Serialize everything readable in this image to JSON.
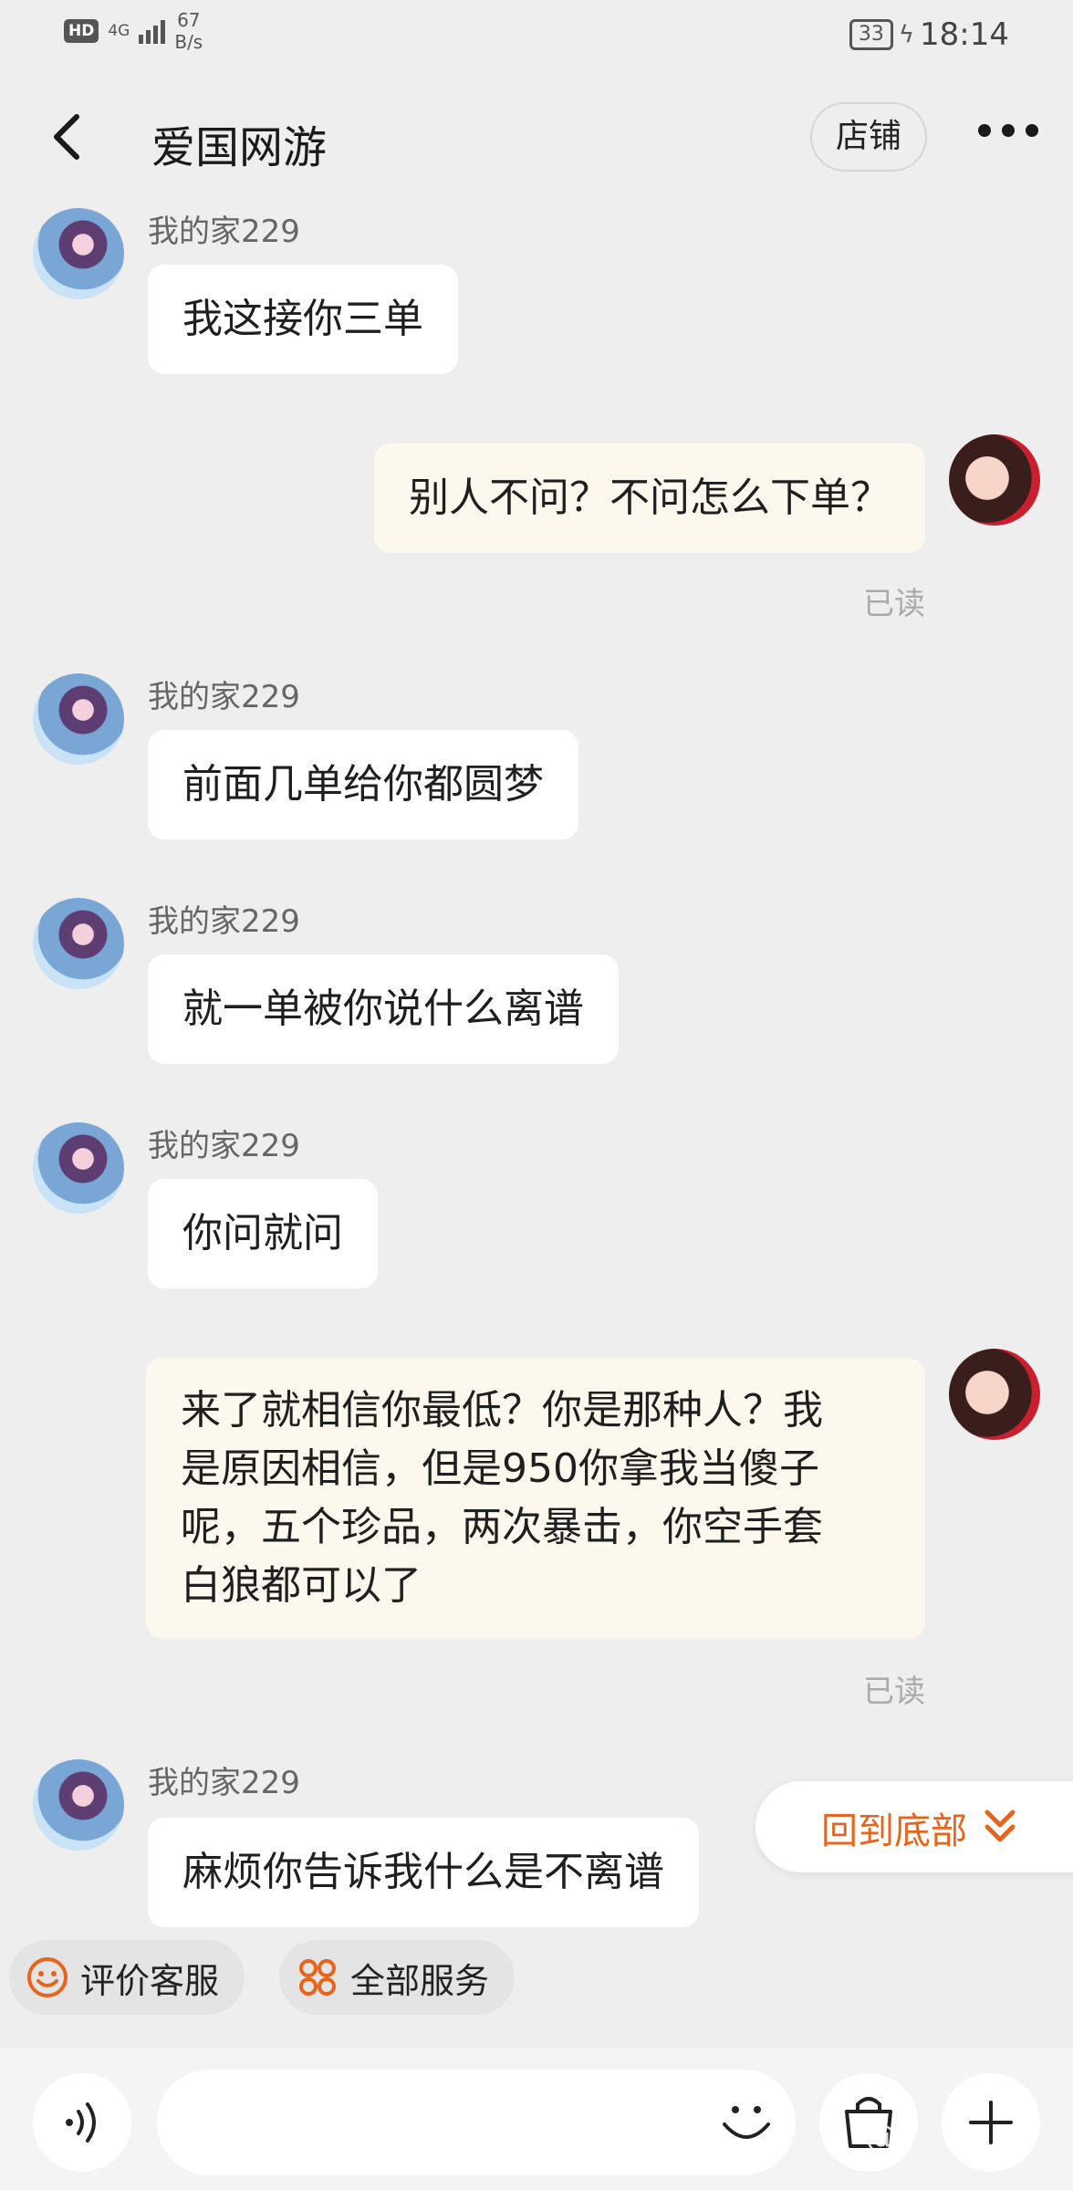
{
  "status_bar": {
    "hd": "HD",
    "network": "4G",
    "speed_value": "67",
    "speed_unit": "B/s",
    "battery": "33",
    "time": "18:14"
  },
  "header": {
    "title": "爱国网游",
    "shop_label": "店铺"
  },
  "messages": [
    {
      "side": "left",
      "sender": "我的家229",
      "text": "我这接你三单"
    },
    {
      "side": "right",
      "text": "别人不问？不问怎么下单？",
      "status": "已读"
    },
    {
      "side": "left",
      "sender": "我的家229",
      "text": "前面几单给你都圆梦"
    },
    {
      "side": "left",
      "sender": "我的家229",
      "text": "就一单被你说什么离谱"
    },
    {
      "side": "left",
      "sender": "我的家229",
      "text": "你问就问"
    },
    {
      "side": "right",
      "lines": [
        "来了就相信你最低？你是那种人？我",
        "是原因相信，但是950你拿我当傻子",
        "呢，五个珍品，两次暴击，你空手套",
        "白狼都可以了"
      ],
      "status": "已读"
    },
    {
      "side": "left",
      "sender": "我的家229",
      "text": "麻烦你告诉我什么是不离谱"
    }
  ],
  "back_to_bottom_label": "回到底部",
  "quick_actions": [
    {
      "label": "评价客服",
      "icon": "smiley-icon"
    },
    {
      "label": "全部服务",
      "icon": "grid-icon"
    }
  ],
  "colors": {
    "accent": "#e8641b",
    "background": "#eeeeee",
    "bubble_left": "#ffffff",
    "bubble_right": "#fdf8ed",
    "read_status": "#aaaaaa"
  },
  "watermark": "@"
}
